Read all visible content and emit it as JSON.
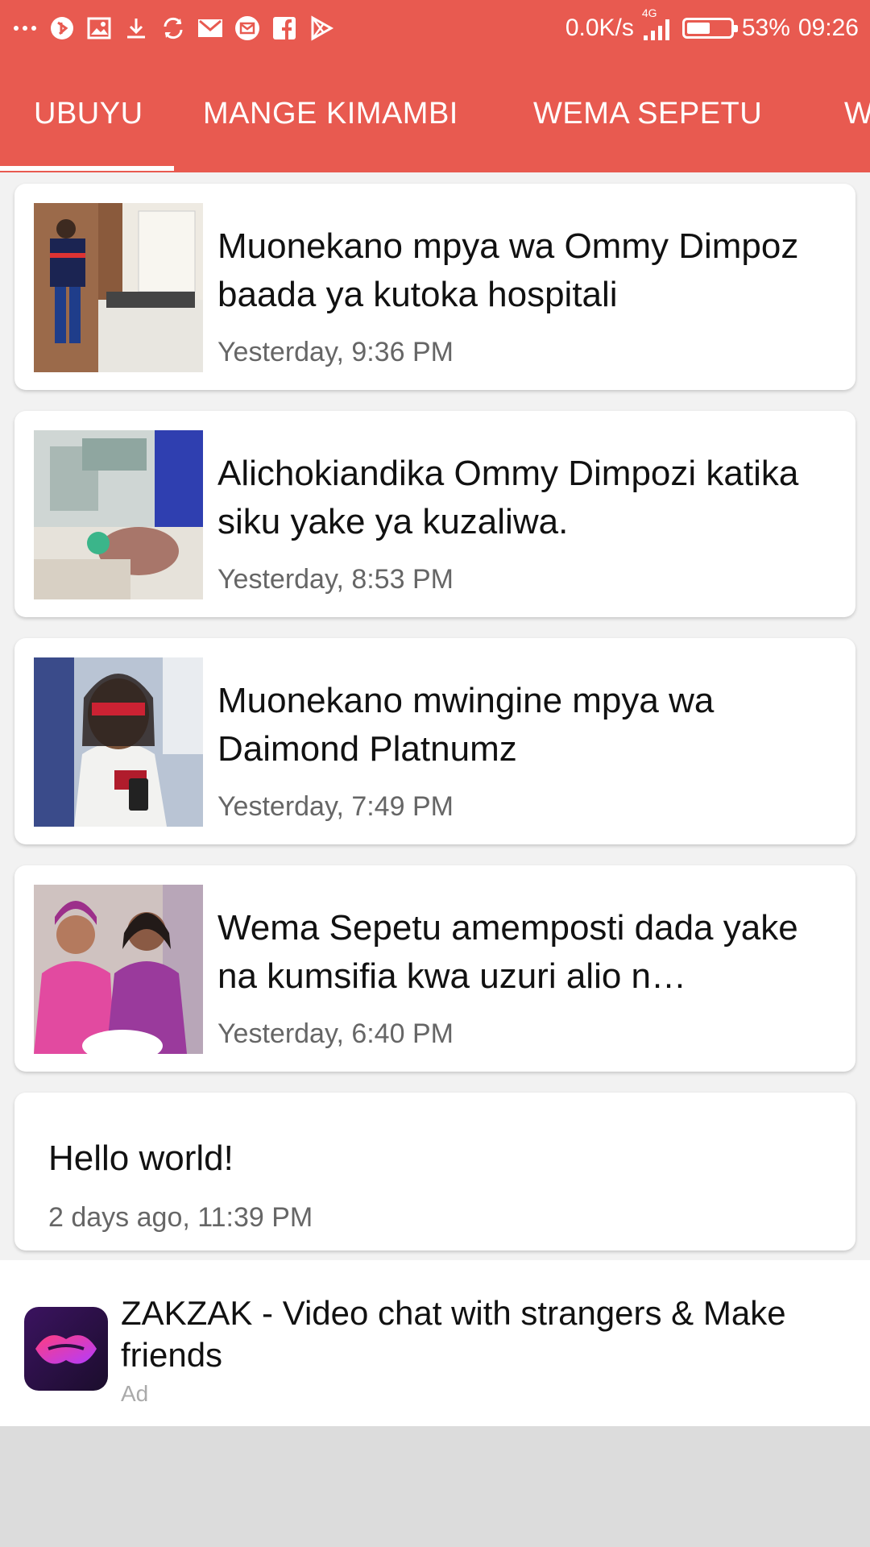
{
  "status_bar": {
    "network_speed": "0.0K/s",
    "network_type": "4G",
    "battery_percent": "53%",
    "battery_level": 0.53,
    "time": "09:26",
    "left_icons": [
      "more-dots-icon",
      "app-icon",
      "gallery-icon",
      "download-icon",
      "sync-icon",
      "gmail-icon",
      "email-icon",
      "facebook-icon",
      "play-store-icon"
    ]
  },
  "tabs": [
    {
      "label": "UBUYU",
      "active": true
    },
    {
      "label": "MANGE KIMAMBI",
      "active": false
    },
    {
      "label": "WEMA SEPETU",
      "active": false
    },
    {
      "label": "W",
      "active": false
    }
  ],
  "colors": {
    "accent": "#e85a50",
    "background": "#f2f2f2",
    "bottom": "#dcdcdc"
  },
  "articles": [
    {
      "title": "Muonekano mpya wa Ommy Dimpoz baada ya kutoka hospitali",
      "time": "Yesterday, 9:36 PM"
    },
    {
      "title": "Alichokiandika Ommy Dimpozi katika siku yake ya kuzaliwa.",
      "time": "Yesterday, 8:53 PM"
    },
    {
      "title": "Muonekano mwingine mpya wa Daimond Platnumz",
      "time": "Yesterday, 7:49 PM"
    },
    {
      "title": "Wema Sepetu amemposti dada yake na kumsifia kwa uzuri alio n…",
      "time": "Yesterday, 6:40 PM"
    },
    {
      "title": "Hello world!",
      "time": "2 days ago, 11:39 PM"
    }
  ],
  "ad": {
    "title": "ZAKZAK - Video chat with strangers & Make friends",
    "label": "Ad"
  }
}
